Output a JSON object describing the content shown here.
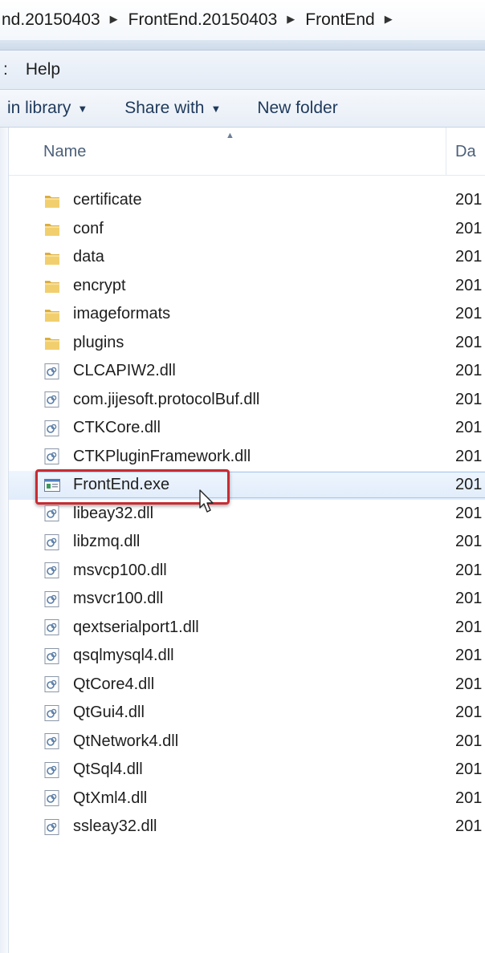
{
  "address": {
    "crumbs": [
      "nd.20150403",
      "FrontEnd.20150403",
      "FrontEnd"
    ],
    "separator_icon": "chevron-right-icon"
  },
  "menu": {
    "fragment": ":",
    "help": "Help"
  },
  "toolbar": {
    "include_library": "in library",
    "share_with": "Share with",
    "new_folder": "New folder"
  },
  "columns": {
    "name": "Name",
    "date": "Da"
  },
  "files": [
    {
      "name": "certificate",
      "type": "folder",
      "date": "201"
    },
    {
      "name": "conf",
      "type": "folder",
      "date": "201"
    },
    {
      "name": "data",
      "type": "folder",
      "date": "201"
    },
    {
      "name": "encrypt",
      "type": "folder",
      "date": "201"
    },
    {
      "name": "imageformats",
      "type": "folder",
      "date": "201"
    },
    {
      "name": "plugins",
      "type": "folder",
      "date": "201"
    },
    {
      "name": "CLCAPIW2.dll",
      "type": "dll",
      "date": "201"
    },
    {
      "name": "com.jijesoft.protocolBuf.dll",
      "type": "dll",
      "date": "201"
    },
    {
      "name": "CTKCore.dll",
      "type": "dll",
      "date": "201"
    },
    {
      "name": "CTKPluginFramework.dll",
      "type": "dll",
      "date": "201"
    },
    {
      "name": "FrontEnd.exe",
      "type": "exe",
      "date": "201",
      "selected": true
    },
    {
      "name": "libeay32.dll",
      "type": "dll",
      "date": "201"
    },
    {
      "name": "libzmq.dll",
      "type": "dll",
      "date": "201"
    },
    {
      "name": "msvcp100.dll",
      "type": "dll",
      "date": "201"
    },
    {
      "name": "msvcr100.dll",
      "type": "dll",
      "date": "201"
    },
    {
      "name": "qextserialport1.dll",
      "type": "dll",
      "date": "201"
    },
    {
      "name": "qsqlmysql4.dll",
      "type": "dll",
      "date": "201"
    },
    {
      "name": "QtCore4.dll",
      "type": "dll",
      "date": "201"
    },
    {
      "name": "QtGui4.dll",
      "type": "dll",
      "date": "201"
    },
    {
      "name": "QtNetwork4.dll",
      "type": "dll",
      "date": "201"
    },
    {
      "name": "QtSql4.dll",
      "type": "dll",
      "date": "201"
    },
    {
      "name": "QtXml4.dll",
      "type": "dll",
      "date": "201"
    },
    {
      "name": "ssleay32.dll",
      "type": "dll",
      "date": "201"
    }
  ],
  "colors": {
    "highlight_border": "#c72c33",
    "selection_fill": "#e1ecfb",
    "folder_yellow": "#e8c25a"
  }
}
